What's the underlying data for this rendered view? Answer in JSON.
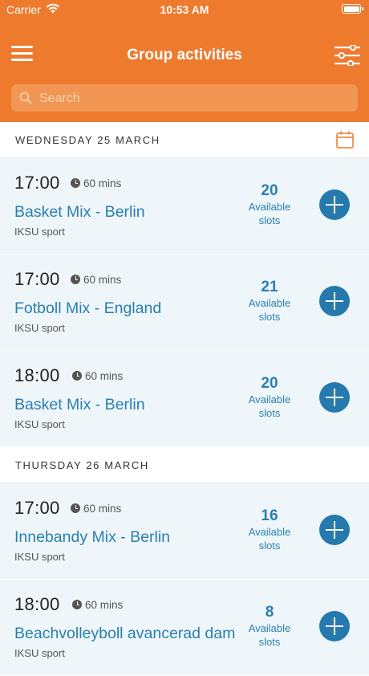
{
  "status_bar": {
    "carrier": "Carrier",
    "time": "10:53 AM",
    "battery_level": 1.0
  },
  "header": {
    "title": "Group activities",
    "menu_icon": "hamburger-menu-icon",
    "filter_icon": "filter-sliders-icon"
  },
  "search": {
    "placeholder": "Search",
    "value": ""
  },
  "days": [
    {
      "label": "WEDNESDAY 25 MARCH",
      "activities": [
        {
          "time": "17:00",
          "duration": "60 mins",
          "name": "Basket Mix - Berlin",
          "venue": "IKSU sport",
          "slots": "20",
          "slots_label_1": "Available",
          "slots_label_2": "slots"
        },
        {
          "time": "17:00",
          "duration": "60 mins",
          "name": "Fotboll Mix - England",
          "venue": "IKSU sport",
          "slots": "21",
          "slots_label_1": "Available",
          "slots_label_2": "slots"
        },
        {
          "time": "18:00",
          "duration": "60 mins",
          "name": "Basket Mix - Berlin",
          "venue": "IKSU sport",
          "slots": "20",
          "slots_label_1": "Available",
          "slots_label_2": "slots"
        }
      ]
    },
    {
      "label": "THURSDAY 26 MARCH",
      "activities": [
        {
          "time": "17:00",
          "duration": "60 mins",
          "name": "Innebandy Mix - Berlin",
          "venue": "IKSU sport",
          "slots": "16",
          "slots_label_1": "Available",
          "slots_label_2": "slots"
        },
        {
          "time": "18:00",
          "duration": "60 mins",
          "name": "Beachvolleyboll avancerad dam",
          "venue": "IKSU sport",
          "slots": "8",
          "slots_label_1": "Available",
          "slots_label_2": "slots"
        }
      ]
    }
  ],
  "colors": {
    "brand_orange": "#ee7a2e",
    "accent_blue": "#2a7fb1",
    "card_background": "#eef6fa"
  }
}
